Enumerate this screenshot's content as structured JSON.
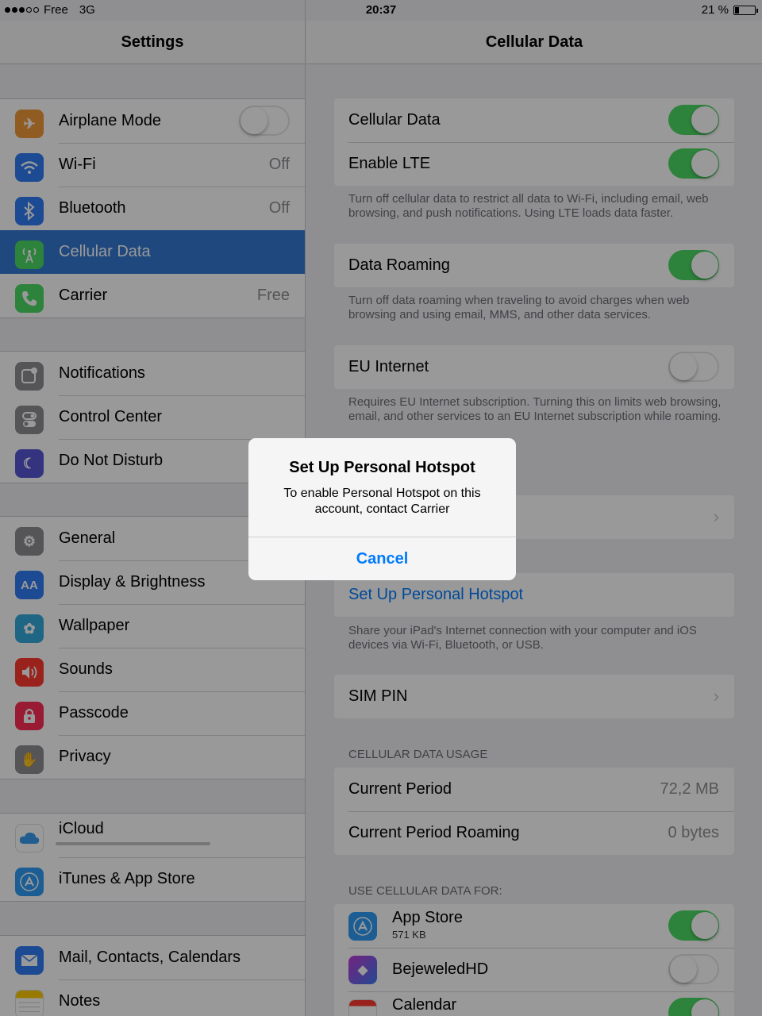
{
  "status": {
    "carrier": "Free",
    "network": "3G",
    "time": "20:37",
    "battery": "21 %"
  },
  "left": {
    "title": "Settings",
    "group1": [
      {
        "label": "Airplane Mode",
        "icon": "airplane-icon",
        "color": "#f19a38"
      },
      {
        "label": "Wi-Fi",
        "value": "Off",
        "icon": "wifi-icon",
        "color": "#2f7cf6"
      },
      {
        "label": "Bluetooth",
        "value": "Off",
        "icon": "bluetooth-icon",
        "color": "#2f7cf6"
      },
      {
        "label": "Cellular Data",
        "icon": "antenna-icon",
        "color": "#4cd964"
      },
      {
        "label": "Carrier",
        "value": "Free",
        "icon": "phone-icon",
        "color": "#4cd964"
      }
    ],
    "group2": [
      {
        "label": "Notifications",
        "icon": "notifications-icon",
        "color": "#8e8e93"
      },
      {
        "label": "Control Center",
        "icon": "control-center-icon",
        "color": "#8e8e93"
      },
      {
        "label": "Do Not Disturb",
        "icon": "moon-icon",
        "color": "#5856d6"
      }
    ],
    "group3": [
      {
        "label": "General",
        "icon": "gear-icon",
        "color": "#8e8e93"
      },
      {
        "label": "Display & Brightness",
        "icon": "display-icon",
        "color": "#2f7cf6"
      },
      {
        "label": "Wallpaper",
        "icon": "wallpaper-icon",
        "color": "#34aadc"
      },
      {
        "label": "Sounds",
        "icon": "speaker-icon",
        "color": "#ff3b30"
      },
      {
        "label": "Passcode",
        "icon": "lock-icon",
        "color": "#ff2d55"
      },
      {
        "label": "Privacy",
        "icon": "hand-icon",
        "color": "#8e8e93"
      }
    ],
    "group4": [
      {
        "label": "iCloud",
        "icon": "cloud-icon",
        "color": "#ffffff"
      },
      {
        "label": "iTunes & App Store",
        "icon": "app-store-icon",
        "color": "#2f9df6"
      }
    ],
    "group5": [
      {
        "label": "Mail, Contacts, Calendars",
        "icon": "mail-icon",
        "color": "#2f7cf6"
      },
      {
        "label": "Notes",
        "icon": "notes-icon",
        "color": "#ffcc00"
      }
    ]
  },
  "right": {
    "title": "Cellular Data",
    "cellular_data": "Cellular Data",
    "enable_lte": "Enable LTE",
    "note1": "Turn off cellular data to restrict all data to Wi-Fi, including email, web browsing, and push notifications. Using LTE loads data faster.",
    "data_roaming": "Data Roaming",
    "note2": "Turn off data roaming when traveling to avoid charges when web browsing and using email, MMS, and other data services.",
    "eu_internet": "EU Internet",
    "note3": "Requires EU Internet subscription. Turning this on limits web browsing, email, and other services to an EU Internet subscription while roaming.",
    "setup_hotspot": "Set Up Personal Hotspot",
    "note4": "Share your iPad's Internet connection with your computer and iOS devices via Wi-Fi, Bluetooth, or USB.",
    "sim_pin": "SIM PIN",
    "usage_header": "CELLULAR DATA USAGE",
    "current_period": "Current Period",
    "current_period_value": "72,2 MB",
    "current_roaming": "Current Period Roaming",
    "current_roaming_value": "0 bytes",
    "use_header": "USE CELLULAR DATA FOR:",
    "apps": [
      {
        "label": "App Store",
        "sub": "571 KB"
      },
      {
        "label": "BejeweledHD"
      },
      {
        "label": "Calendar"
      }
    ]
  },
  "alert": {
    "title": "Set Up Personal Hotspot",
    "message": "To enable Personal Hotspot on this account, contact Carrier",
    "cancel": "Cancel"
  }
}
